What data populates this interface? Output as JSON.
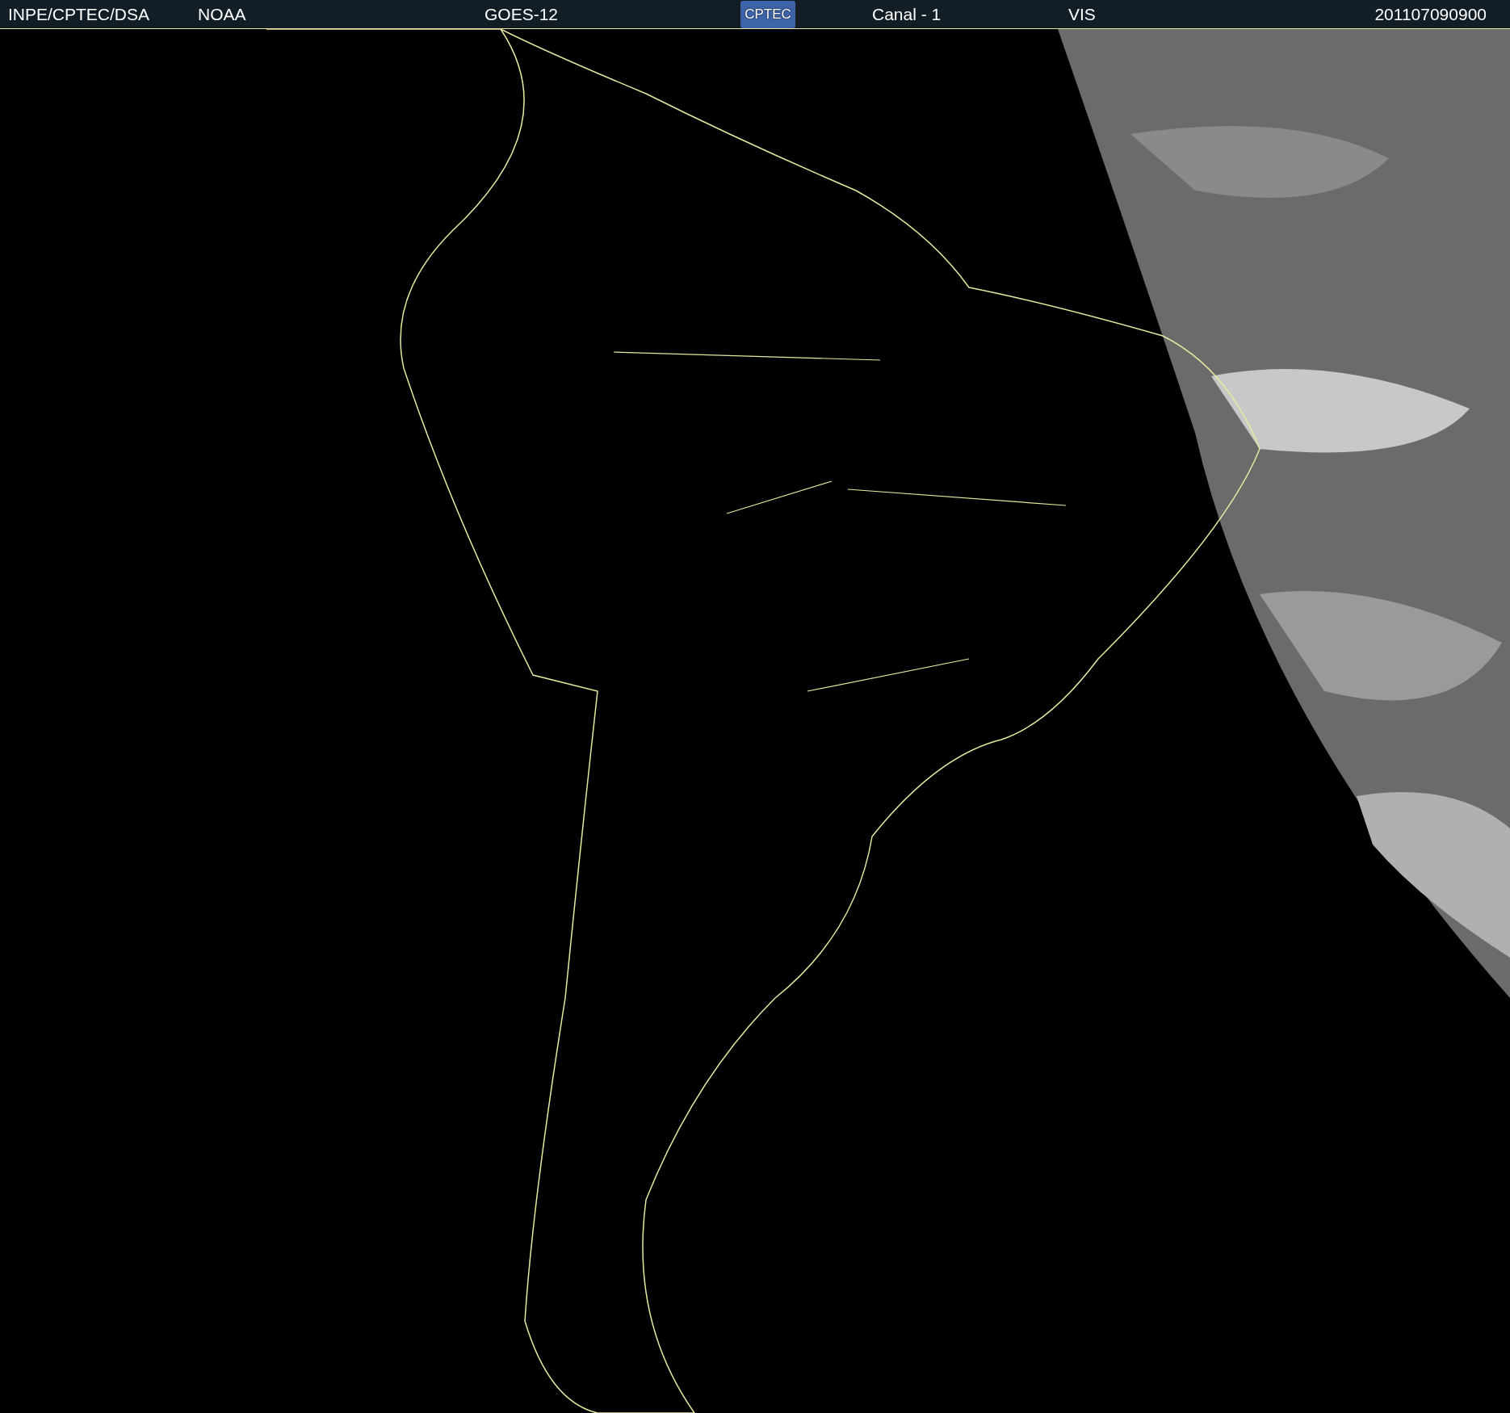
{
  "header": {
    "agency": "INPE/CPTEC/DSA",
    "provider": "NOAA",
    "satellite": "GOES-12",
    "logo_text": "CPTEC",
    "channel": "Canal - 1",
    "band": "VIS",
    "timestamp": "201107090900"
  }
}
